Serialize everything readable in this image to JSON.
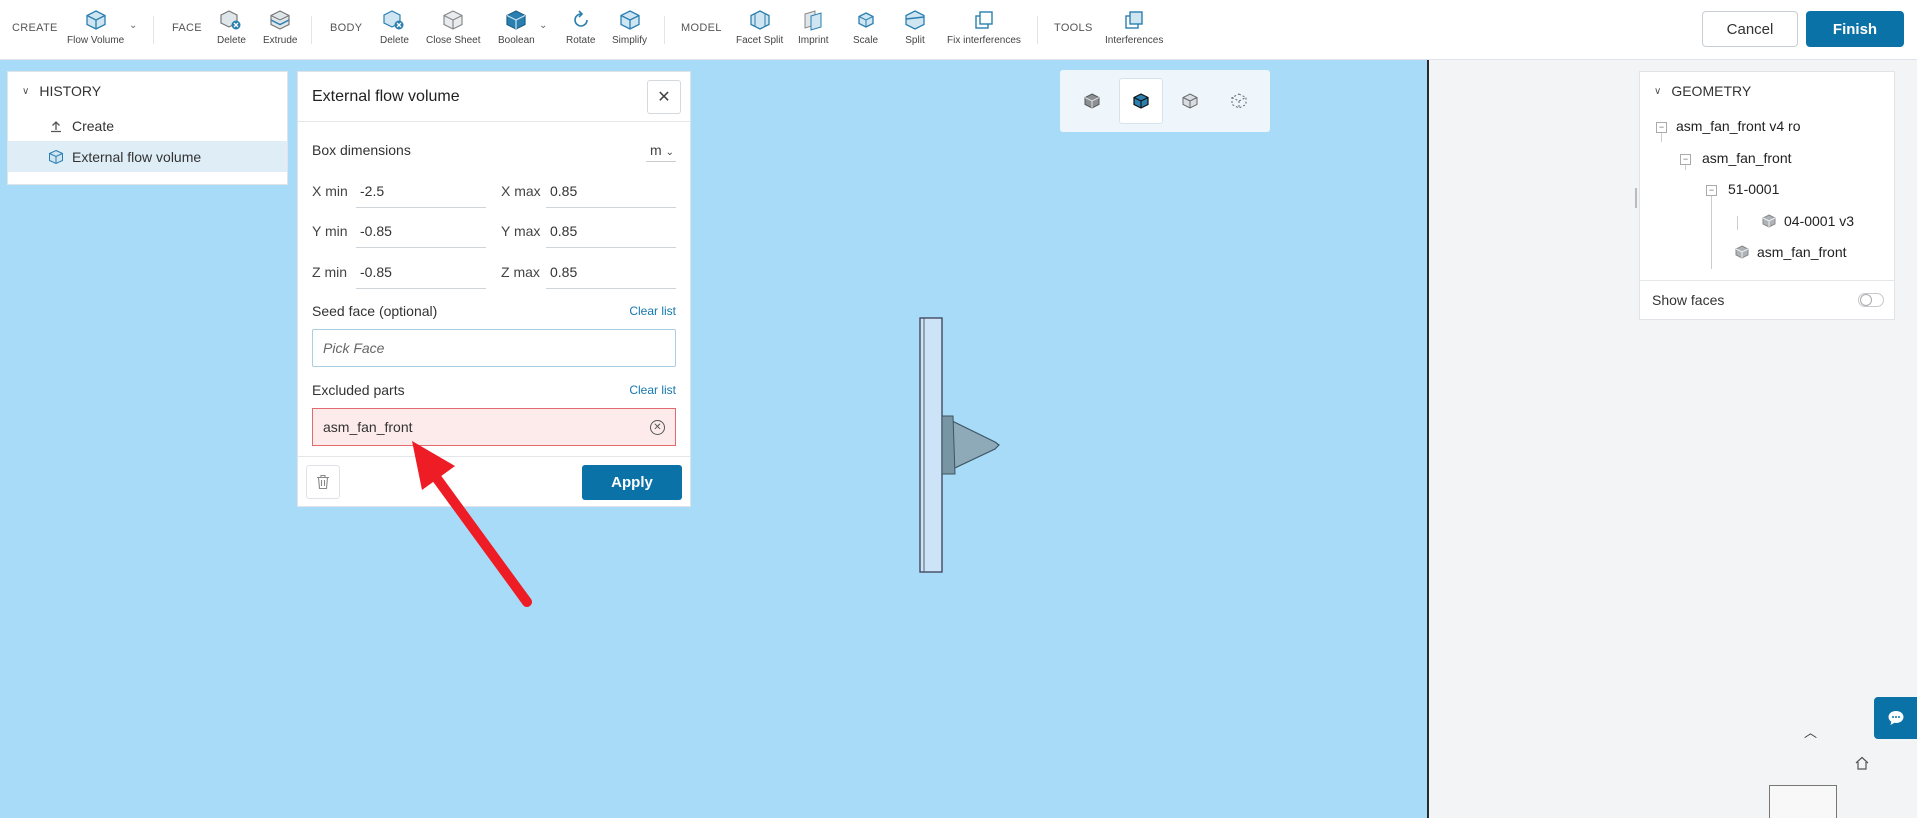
{
  "toolbar": {
    "groups": {
      "create": "CREATE",
      "face": "FACE",
      "body": "BODY",
      "model": "MODEL",
      "tools": "TOOLS"
    },
    "buttons": {
      "flow_volume": "Flow Volume",
      "face_delete": "Delete",
      "extrude": "Extrude",
      "body_delete": "Delete",
      "close_sheet": "Close Sheet",
      "boolean": "Boolean",
      "rotate": "Rotate",
      "simplify": "Simplify",
      "facet_split": "Facet Split",
      "imprint": "Imprint",
      "scale": "Scale",
      "split": "Split",
      "fix_interferences": "Fix interferences",
      "interferences": "Interferences"
    },
    "cancel": "Cancel",
    "finish": "Finish"
  },
  "history": {
    "title": "HISTORY",
    "items": [
      {
        "label": "Create",
        "icon": "upload-icon"
      },
      {
        "label": "External flow volume",
        "icon": "cube-icon"
      }
    ]
  },
  "flow_volume_panel": {
    "title": "External flow volume",
    "box_dimensions_label": "Box dimensions",
    "unit": "m",
    "dims": {
      "x_min_label": "X min",
      "x_min": "-2.5",
      "x_max_label": "X max",
      "x_max": "0.85",
      "y_min_label": "Y min",
      "y_min": "-0.85",
      "y_max_label": "Y max",
      "y_max": "0.85",
      "z_min_label": "Z min",
      "z_min": "-0.85",
      "z_max_label": "Z max",
      "z_max": "0.85"
    },
    "seed_face_label": "Seed face (optional)",
    "clear_list": "Clear list",
    "pick_face_placeholder": "Pick Face",
    "excluded_parts_label": "Excluded parts",
    "excluded_value": "asm_fan_front",
    "apply": "Apply"
  },
  "geometry": {
    "title": "GEOMETRY",
    "tree": [
      {
        "label": "asm_fan_front v4 ro"
      },
      {
        "label": "asm_fan_front"
      },
      {
        "label": "51-0001"
      },
      {
        "label": "04-0001 v3"
      },
      {
        "label": "asm_fan_front"
      }
    ],
    "show_faces": "Show faces"
  },
  "colors": {
    "accent": "#0b72a8",
    "viewport": "#a8dbf7",
    "error_border": "#e06a6e",
    "annotation_arrow": "#ee1c25"
  }
}
